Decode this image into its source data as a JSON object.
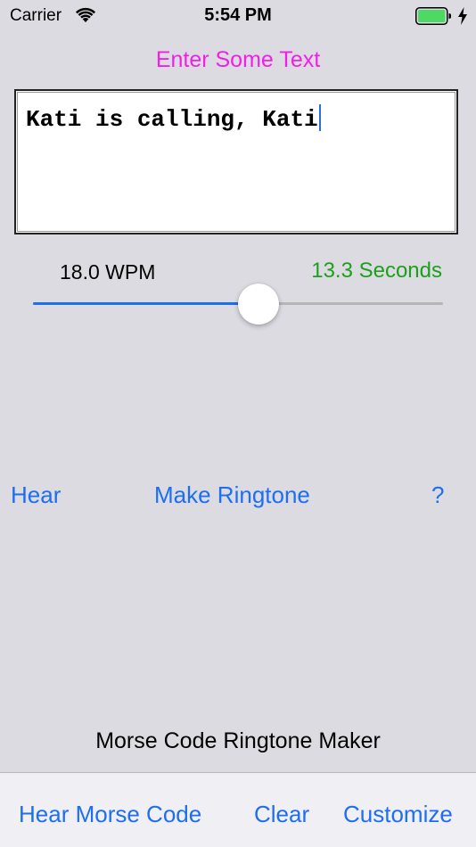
{
  "status_bar": {
    "carrier": "Carrier",
    "time": "5:54 PM",
    "icons": [
      "wifi-icon",
      "battery-icon",
      "charging-bolt-icon"
    ],
    "battery_color": "#4cd964"
  },
  "prompt_label": "Enter Some Text",
  "text_input": {
    "value": "Kati is calling, Kati"
  },
  "speed": {
    "wpm_label": "18.0 WPM",
    "duration_label": "13.3 Seconds",
    "slider_fraction": 0.55
  },
  "actions": {
    "hear": "Hear",
    "make_ringtone": "Make Ringtone",
    "help": "?"
  },
  "app_title": "Morse Code Ringtone Maker",
  "toolbar": {
    "hear_morse_code": "Hear Morse Code",
    "clear": "Clear",
    "customize": "Customize"
  },
  "colors": {
    "accent": "#1d6ef0",
    "prompt": "#f020e8",
    "seconds": "#1ca01c",
    "background": "#dcdbe2"
  }
}
